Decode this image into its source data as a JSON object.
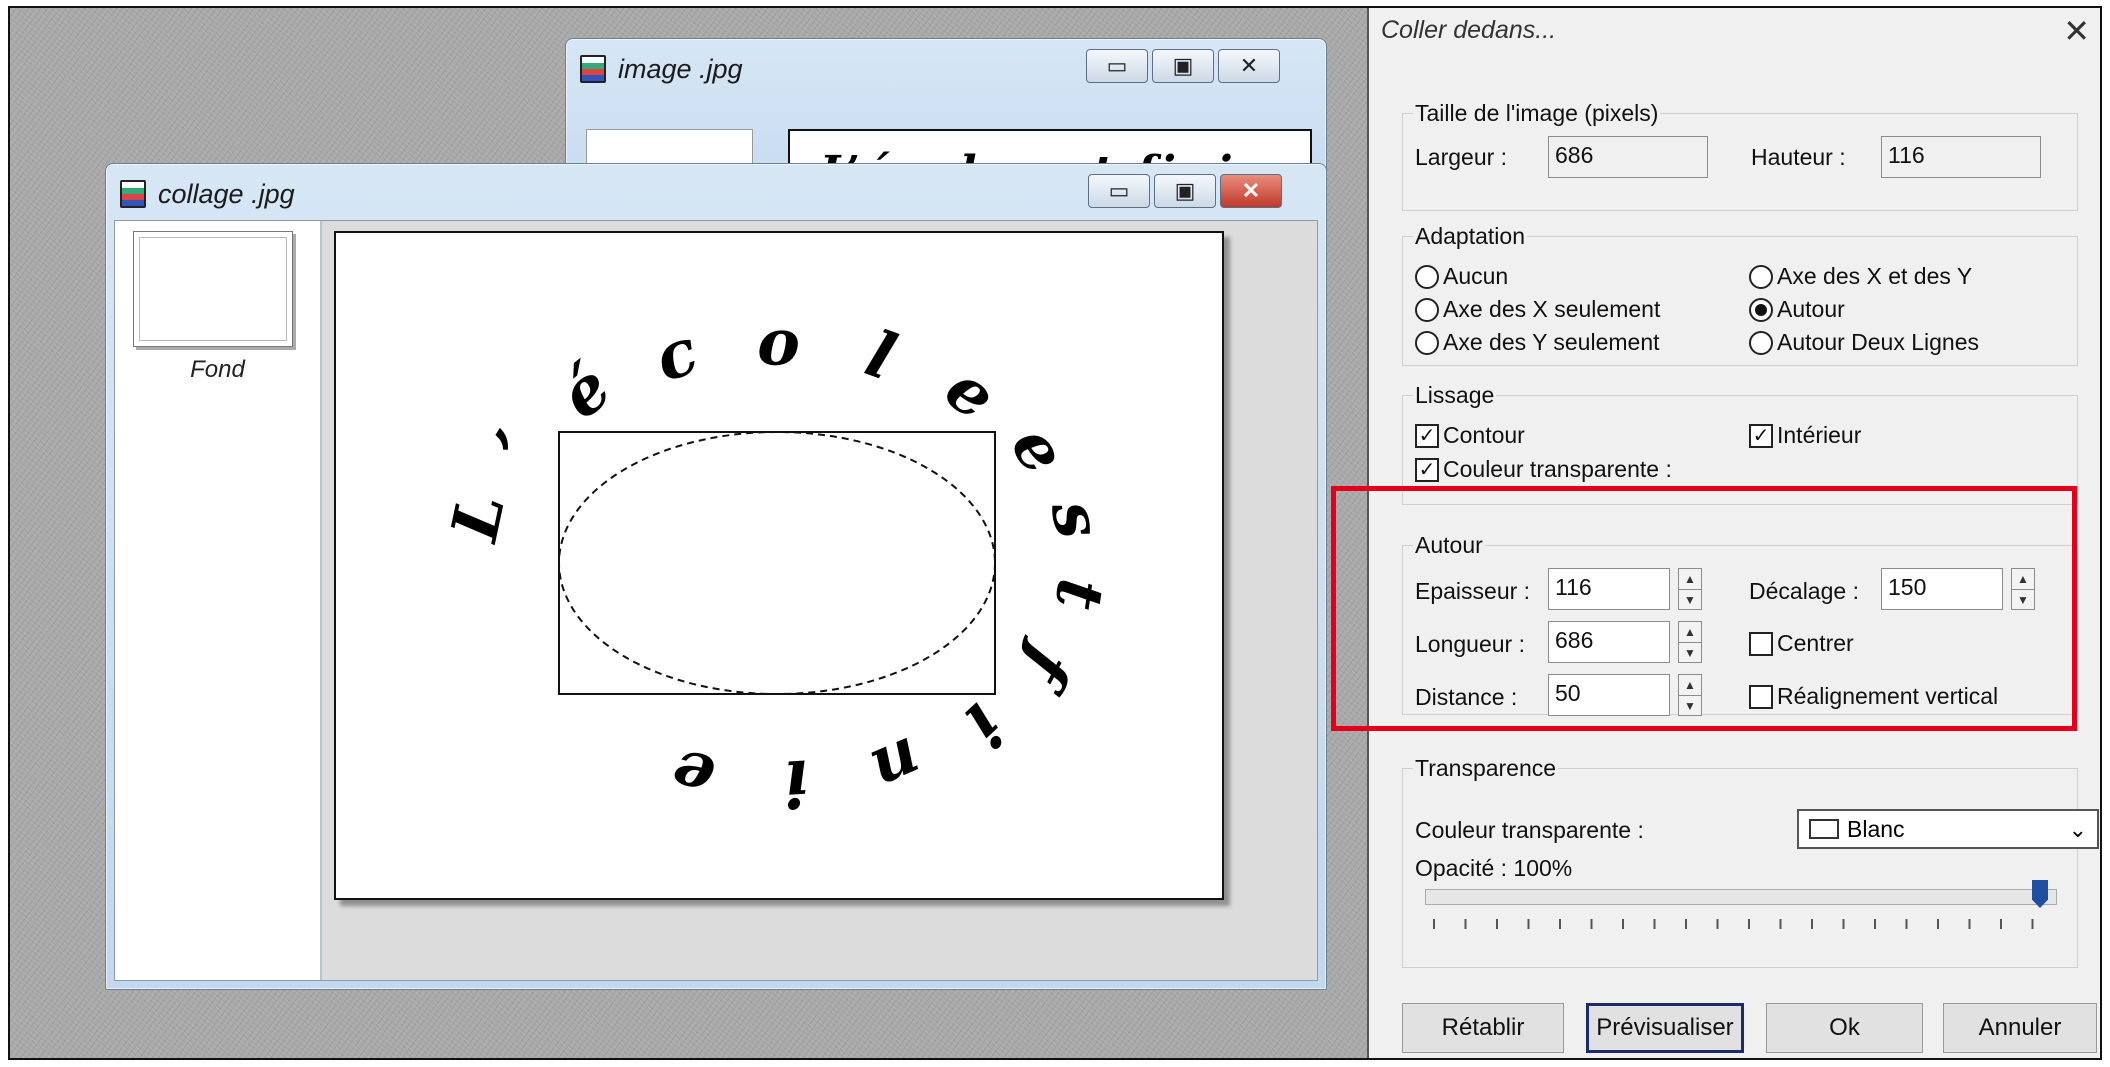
{
  "windows": {
    "back": {
      "title": "image .jpg",
      "preview_text": "L’école est finie"
    },
    "front": {
      "title": "collage .jpg",
      "layer_label": "Fond",
      "curved_text": [
        "L",
        "’",
        "é",
        "c",
        "o",
        "l",
        "e",
        "e",
        "s",
        "t",
        "f",
        "i",
        "n",
        "i",
        "e"
      ]
    }
  },
  "dialog": {
    "title": "Coller dedans...",
    "close_glyph": "✕",
    "image_size": {
      "legend": "Taille de l'image (pixels)",
      "width_label": "Largeur :",
      "width_value": "686",
      "height_label": "Hauteur :",
      "height_value": "116"
    },
    "adaptation": {
      "legend": "Adaptation",
      "options": [
        "Aucun",
        "Axe des X et des Y",
        "Axe des X seulement",
        "Autour",
        "Axe des Y seulement",
        "Autour Deux Lignes"
      ],
      "selected": "Autour"
    },
    "smoothing": {
      "legend": "Lissage",
      "contour": "Contour",
      "interior": "Intérieur",
      "transparent": "Couleur transparente :",
      "contour_checked": true,
      "interior_checked": true,
      "transparent_checked": true
    },
    "around": {
      "legend": "Autour",
      "thickness_label": "Epaisseur :",
      "thickness_value": "116",
      "offset_label": "Décalage :",
      "offset_value": "150",
      "length_label": "Longueur :",
      "length_value": "686",
      "center_label": "Centrer",
      "distance_label": "Distance :",
      "distance_value": "50",
      "realign_label": "Réalignement vertical"
    },
    "transparency": {
      "legend": "Transparence",
      "color_label": "Couleur transparente :",
      "color_value": "Blanc",
      "opacity_label": "Opacité : 100%",
      "opacity": 1.0
    },
    "buttons": {
      "reset": "Rétablir",
      "preview": "Prévisualiser",
      "ok": "Ok",
      "cancel": "Annuler"
    }
  },
  "colors": {
    "highlight": "#e3001b",
    "desktop": "#a9a9a9",
    "dialog_bg": "#f0f0f0",
    "slider_thumb": "#1f4fa0"
  }
}
